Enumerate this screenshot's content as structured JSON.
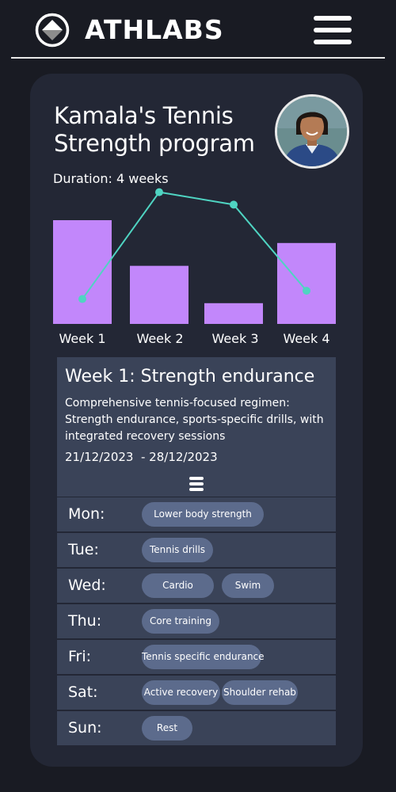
{
  "app": {
    "brand": "ATHLABS"
  },
  "program": {
    "title": "Kamala's Tennis Strength program",
    "duration": "Duration: 4 weeks"
  },
  "chart_data": {
    "type": "bar",
    "categories": [
      "Week 1",
      "Week 2",
      "Week 3",
      "Week 4"
    ],
    "series": [
      {
        "values": [
          100,
          56,
          20,
          78
        ],
        "color": "#c287fb"
      },
      {
        "values": [
          24,
          127,
          115,
          32
        ],
        "color": "#4fd4c2"
      }
    ]
  },
  "week": {
    "title": "Week 1: Strength endurance",
    "description": "Comprehensive tennis-focused regimen: Strength endurance, sports-specific drills, with integrated recovery sessions",
    "dates": "21/12/2023  - 28/12/2023"
  },
  "schedule": [
    {
      "day": "Mon:",
      "activities": [
        "Lower body strength"
      ]
    },
    {
      "day": "Tue:",
      "activities": [
        "Tennis drills"
      ]
    },
    {
      "day": "Wed:",
      "activities": [
        "Cardio",
        "Swim"
      ]
    },
    {
      "day": "Thu:",
      "activities": [
        "Core training"
      ]
    },
    {
      "day": "Fri:",
      "activities": [
        "Tennis specific endurance"
      ]
    },
    {
      "day": "Sat:",
      "activities": [
        "Active recovery",
        "Shoulder rehab"
      ]
    },
    {
      "day": "Sun:",
      "activities": [
        "Rest"
      ]
    }
  ],
  "colors": {
    "background": "#191b23",
    "card": "#232735",
    "panel": "#3a4358",
    "pill": "#5c6b8c",
    "bar": "#c287fb",
    "line": "#4fd4c2"
  },
  "icons": {
    "logo": "logo-icon",
    "menu": "menu-icon",
    "collapse": "list-toggle-icon"
  }
}
